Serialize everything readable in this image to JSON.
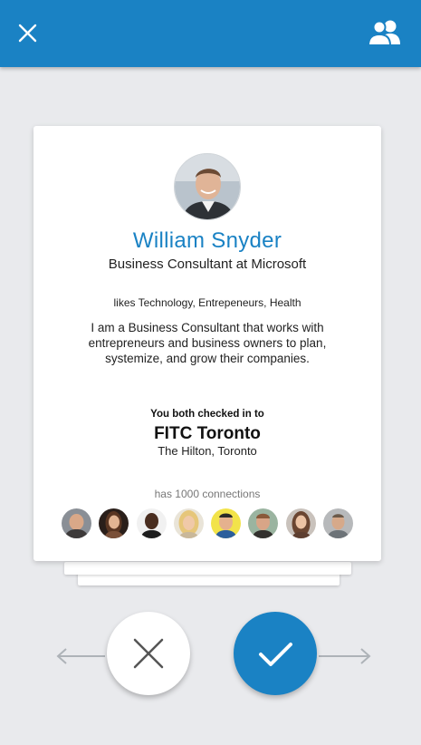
{
  "header": {
    "close_icon": "close-icon",
    "connections_icon": "people-icon",
    "bar_color": "#1a82c4"
  },
  "profile": {
    "name": "William Snyder",
    "title": "Business Consultant at Microsoft",
    "likes_prefix": "likes",
    "likes_values": "Technology, Entrepeneurs, Health",
    "bio": "I am a Business Consultant that works with entrepreneurs and business owners to plan, systemize, and grow their companies.",
    "checkin_label": "You both checked in to",
    "venue_name": "FITC Toronto",
    "venue_location": "The Hilton, Toronto",
    "connections_text": "has 1000 connections",
    "connection_avatars": [
      {
        "name": "connection-1"
      },
      {
        "name": "connection-2"
      },
      {
        "name": "connection-3"
      },
      {
        "name": "connection-4"
      },
      {
        "name": "connection-5"
      },
      {
        "name": "connection-6"
      },
      {
        "name": "connection-7"
      },
      {
        "name": "connection-8"
      }
    ]
  },
  "actions": {
    "reject_icon": "x-icon",
    "accept_icon": "check-icon",
    "left_arrow": "arrow-left-icon",
    "right_arrow": "arrow-right-icon",
    "accent": "#1a82c4"
  }
}
